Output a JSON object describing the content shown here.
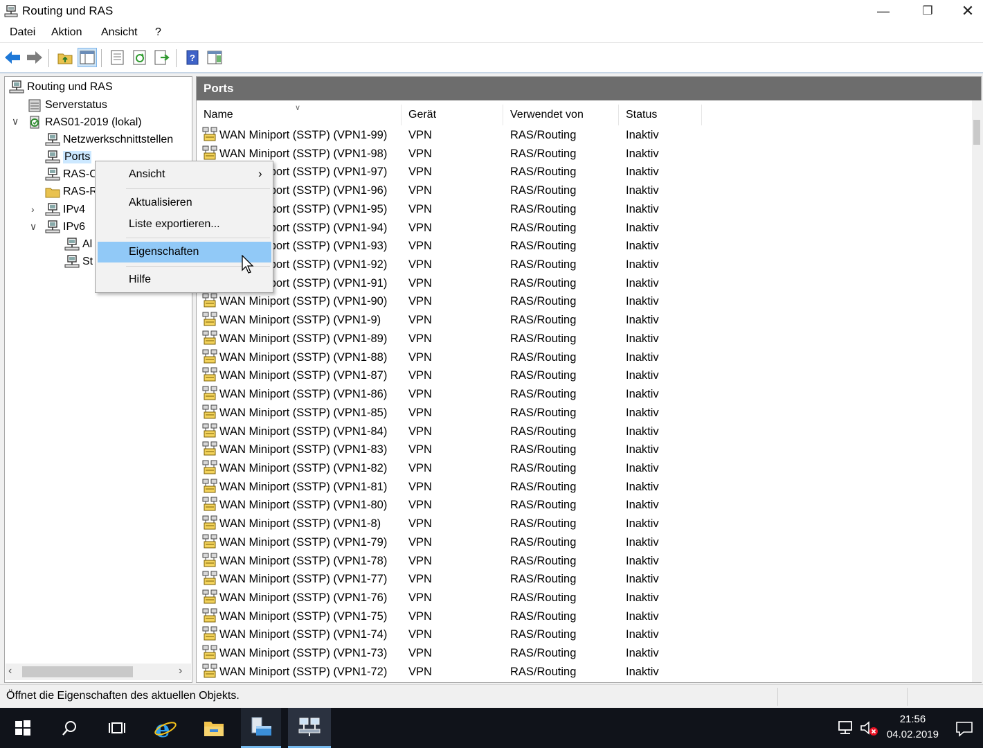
{
  "window": {
    "title": "Routing und RAS"
  },
  "menu": [
    "Datei",
    "Aktion",
    "Ansicht",
    "?"
  ],
  "tree": {
    "root": "Routing und RAS",
    "items": [
      "Serverstatus",
      "RAS01-2019 (lokal)",
      "Netzwerkschnittstellen",
      "Ports",
      "RAS-C",
      "RAS-R",
      "IPv4",
      "IPv6",
      "Al",
      "St"
    ]
  },
  "list": {
    "title": "Ports",
    "columns": [
      "Name",
      "Gerät",
      "Verwendet von",
      "Status"
    ],
    "rows": [
      [
        "WAN Miniport (SSTP) (VPN1-99)",
        "VPN",
        "RAS/Routing",
        "Inaktiv"
      ],
      [
        "WAN Miniport (SSTP) (VPN1-98)",
        "VPN",
        "RAS/Routing",
        "Inaktiv"
      ],
      [
        "WAN Miniport (SSTP) (VPN1-97)",
        "VPN",
        "RAS/Routing",
        "Inaktiv"
      ],
      [
        "WAN Miniport (SSTP) (VPN1-96)",
        "VPN",
        "RAS/Routing",
        "Inaktiv"
      ],
      [
        "WAN Miniport (SSTP) (VPN1-95)",
        "VPN",
        "RAS/Routing",
        "Inaktiv"
      ],
      [
        "WAN Miniport (SSTP) (VPN1-94)",
        "VPN",
        "RAS/Routing",
        "Inaktiv"
      ],
      [
        "WAN Miniport (SSTP) (VPN1-93)",
        "VPN",
        "RAS/Routing",
        "Inaktiv"
      ],
      [
        "WAN Miniport (SSTP) (VPN1-92)",
        "VPN",
        "RAS/Routing",
        "Inaktiv"
      ],
      [
        "WAN Miniport (SSTP) (VPN1-91)",
        "VPN",
        "RAS/Routing",
        "Inaktiv"
      ],
      [
        "WAN Miniport (SSTP) (VPN1-90)",
        "VPN",
        "RAS/Routing",
        "Inaktiv"
      ],
      [
        "WAN Miniport (SSTP) (VPN1-9)",
        "VPN",
        "RAS/Routing",
        "Inaktiv"
      ],
      [
        "WAN Miniport (SSTP) (VPN1-89)",
        "VPN",
        "RAS/Routing",
        "Inaktiv"
      ],
      [
        "WAN Miniport (SSTP) (VPN1-88)",
        "VPN",
        "RAS/Routing",
        "Inaktiv"
      ],
      [
        "WAN Miniport (SSTP) (VPN1-87)",
        "VPN",
        "RAS/Routing",
        "Inaktiv"
      ],
      [
        "WAN Miniport (SSTP) (VPN1-86)",
        "VPN",
        "RAS/Routing",
        "Inaktiv"
      ],
      [
        "WAN Miniport (SSTP) (VPN1-85)",
        "VPN",
        "RAS/Routing",
        "Inaktiv"
      ],
      [
        "WAN Miniport (SSTP) (VPN1-84)",
        "VPN",
        "RAS/Routing",
        "Inaktiv"
      ],
      [
        "WAN Miniport (SSTP) (VPN1-83)",
        "VPN",
        "RAS/Routing",
        "Inaktiv"
      ],
      [
        "WAN Miniport (SSTP) (VPN1-82)",
        "VPN",
        "RAS/Routing",
        "Inaktiv"
      ],
      [
        "WAN Miniport (SSTP) (VPN1-81)",
        "VPN",
        "RAS/Routing",
        "Inaktiv"
      ],
      [
        "WAN Miniport (SSTP) (VPN1-80)",
        "VPN",
        "RAS/Routing",
        "Inaktiv"
      ],
      [
        "WAN Miniport (SSTP) (VPN1-8)",
        "VPN",
        "RAS/Routing",
        "Inaktiv"
      ],
      [
        "WAN Miniport (SSTP) (VPN1-79)",
        "VPN",
        "RAS/Routing",
        "Inaktiv"
      ],
      [
        "WAN Miniport (SSTP) (VPN1-78)",
        "VPN",
        "RAS/Routing",
        "Inaktiv"
      ],
      [
        "WAN Miniport (SSTP) (VPN1-77)",
        "VPN",
        "RAS/Routing",
        "Inaktiv"
      ],
      [
        "WAN Miniport (SSTP) (VPN1-76)",
        "VPN",
        "RAS/Routing",
        "Inaktiv"
      ],
      [
        "WAN Miniport (SSTP) (VPN1-75)",
        "VPN",
        "RAS/Routing",
        "Inaktiv"
      ],
      [
        "WAN Miniport (SSTP) (VPN1-74)",
        "VPN",
        "RAS/Routing",
        "Inaktiv"
      ],
      [
        "WAN Miniport (SSTP) (VPN1-73)",
        "VPN",
        "RAS/Routing",
        "Inaktiv"
      ],
      [
        "WAN Miniport (SSTP) (VPN1-72)",
        "VPN",
        "RAS/Routing",
        "Inaktiv"
      ]
    ]
  },
  "context_menu": {
    "items": [
      "Ansicht",
      "Aktualisieren",
      "Liste exportieren...",
      "Eigenschaften",
      "Hilfe"
    ],
    "highlighted": "Eigenschaften"
  },
  "statusbar": {
    "text": "Öffnet die Eigenschaften des aktuellen Objekts."
  },
  "taskbar": {
    "time": "21:56",
    "date": "04.02.2019"
  },
  "colors": {
    "selection": "#cce8ff",
    "menu_highlight": "#91c9f7",
    "header_bg": "#6d6d6d",
    "taskbar": "#10131a"
  }
}
